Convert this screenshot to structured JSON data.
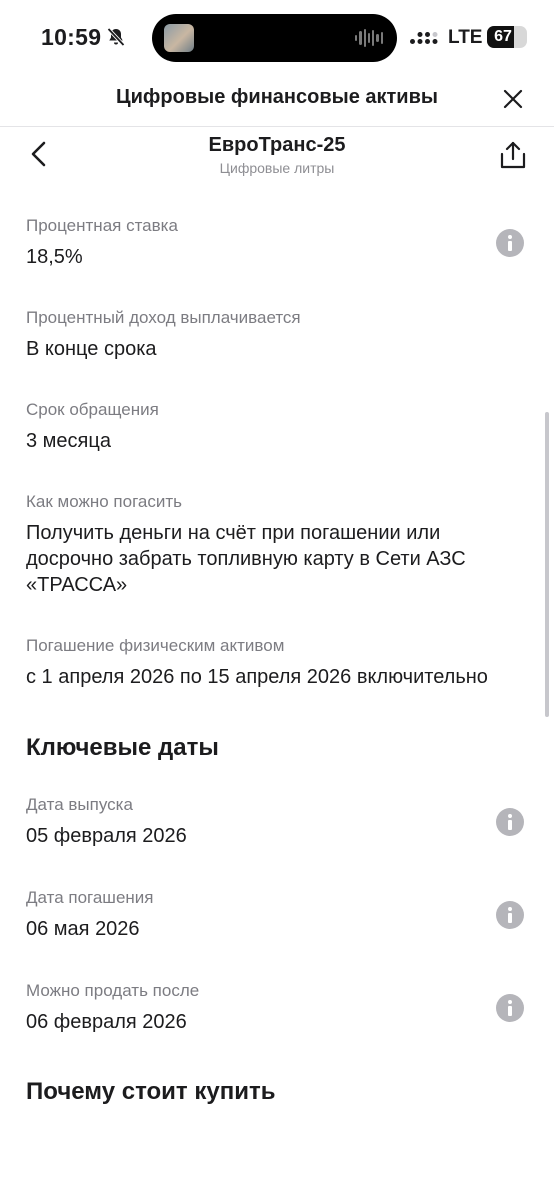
{
  "status_bar": {
    "time": "10:59",
    "network": "LTE",
    "battery_level": "67",
    "battery_fraction": 0.67
  },
  "modal": {
    "title": "Цифровые финансовые активы"
  },
  "asset": {
    "name": "ЕвроТранс-25",
    "type": "Цифровые литры"
  },
  "details": [
    {
      "label": "Процентная ставка",
      "value": "18,5%",
      "has_info": true
    },
    {
      "label": "Процентный доход выплачивается",
      "value": "В конце срока",
      "has_info": false
    },
    {
      "label": "Срок обращения",
      "value": "3 месяца",
      "has_info": false
    },
    {
      "label": "Как можно погасить",
      "value": "Получить деньги на счёт при погашении или досрочно забрать топливную карту в Сети АЗС «ТРАССА»",
      "has_info": false
    },
    {
      "label": "Погашение физическим активом",
      "value": "с 1 апреля 2026 по 15 апреля 2026 включительно",
      "has_info": false
    }
  ],
  "key_dates": {
    "title": "Ключевые даты",
    "items": [
      {
        "label": "Дата выпуска",
        "value": "05 февраля 2026",
        "has_info": true
      },
      {
        "label": "Дата погашения",
        "value": "06 мая 2026",
        "has_info": true
      },
      {
        "label": "Можно продать после",
        "value": "06 февраля 2026",
        "has_info": true
      }
    ]
  },
  "why_buy": {
    "title": "Почему стоит купить"
  },
  "icons": {
    "notifications": "bell-slash-icon",
    "close": "close-icon",
    "back": "chevron-left-icon",
    "share": "share-icon",
    "info": "info-icon"
  },
  "colors": {
    "text_primary": "#1c1c1e",
    "text_secondary": "#7c7c82",
    "info_icon": "#b5b5ba",
    "divider": "#e4e4e7"
  }
}
